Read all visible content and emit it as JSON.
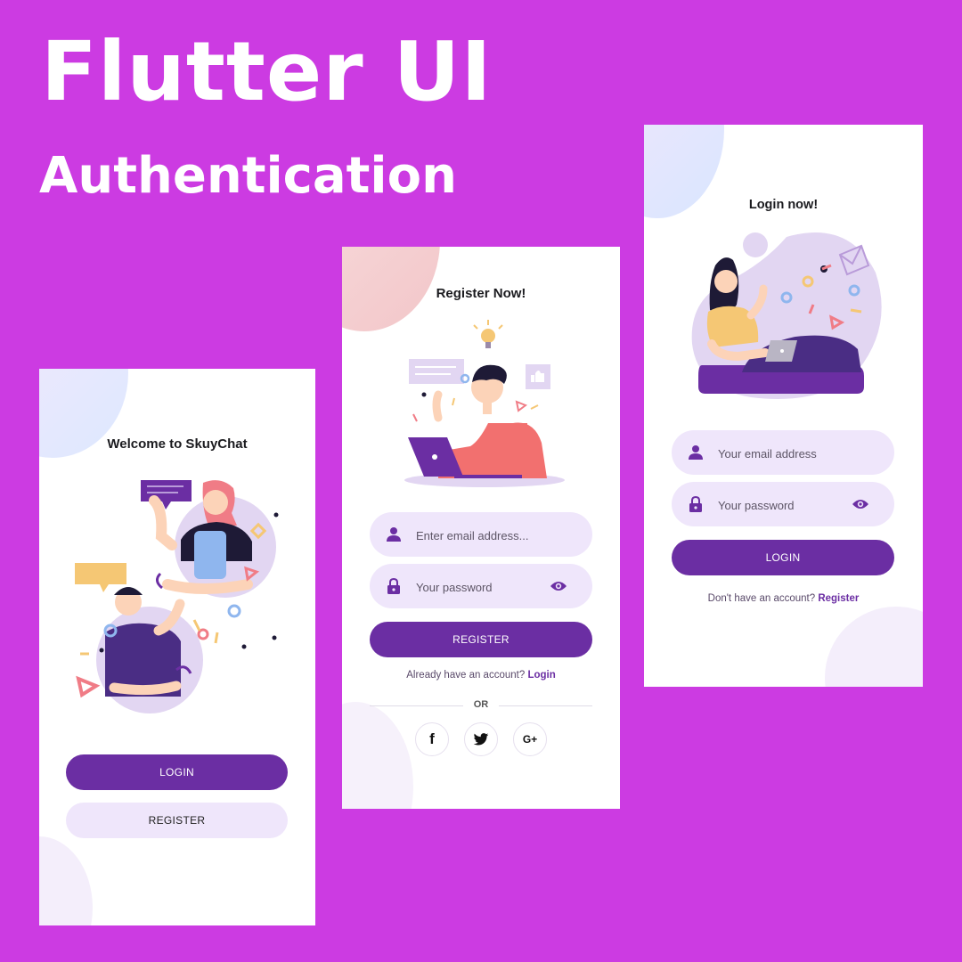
{
  "headline": "Flutter UI",
  "subheadline": "Authentication",
  "colors": {
    "background": "#cc3be2",
    "primary": "#6b2ea3",
    "field": "#efe6fb"
  },
  "welcome": {
    "title": "Welcome to SkuyChat",
    "login_label": "LOGIN",
    "register_label": "REGISTER"
  },
  "register": {
    "title": "Register Now!",
    "email_placeholder": "Enter email address...",
    "password_placeholder": "Your password",
    "register_label": "REGISTER",
    "already_text": "Already have an account?",
    "login_link": "Login",
    "or_text": "OR",
    "socials": [
      {
        "icon": "facebook-icon",
        "glyph": "f"
      },
      {
        "icon": "twitter-icon",
        "glyph": ""
      },
      {
        "icon": "google-plus-icon",
        "glyph": "G+"
      }
    ]
  },
  "login": {
    "title": "Login now!",
    "email_placeholder": "Your email address",
    "password_placeholder": "Your password",
    "login_label": "LOGIN",
    "no_account_text": "Don't have an account?",
    "register_link": "Register"
  }
}
